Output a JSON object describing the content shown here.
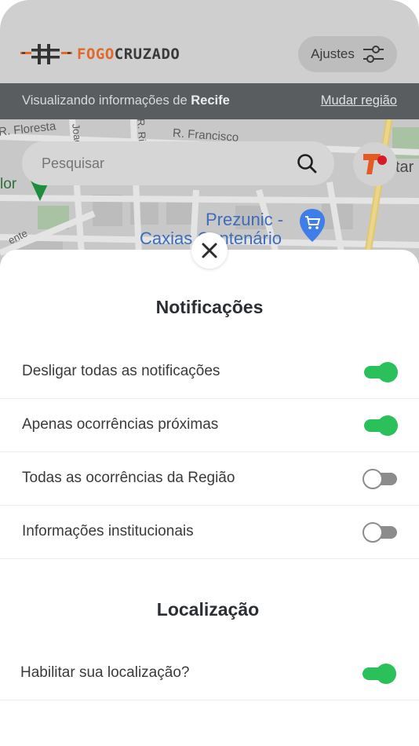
{
  "header": {
    "logo": {
      "text_accent": "FOGO",
      "text_main": "CRUZADO",
      "accent_color": "#e16a2a"
    },
    "settings_label": "Ajustes"
  },
  "region": {
    "prefix": "Visualizando informações de ",
    "city": "Recife",
    "change_label": "Mudar região"
  },
  "map": {
    "streets": [
      "R. Floresta",
      "Joaq",
      "R. Francisco",
      "R. Ri",
      "lor",
      "ente",
      "tar"
    ],
    "poi": {
      "line1": "Prezunic -",
      "line2": "Caxias Centenário"
    }
  },
  "search": {
    "placeholder": "Pesquisar"
  },
  "notifications": {
    "title": "Notificações",
    "items": [
      {
        "label": "Desligar todas as notificações",
        "enabled": true
      },
      {
        "label": "Apenas ocorrências próximas",
        "enabled": true
      },
      {
        "label": "Todas as ocorrências da Região",
        "enabled": false
      },
      {
        "label": "Informações institucionais",
        "enabled": false
      }
    ]
  },
  "location": {
    "title": "Localização",
    "items": [
      {
        "label": "Habilitar sua localização?",
        "enabled": true
      }
    ]
  },
  "colors": {
    "toggle_on": "#2ac05a",
    "toggle_off": "#8c8c8c",
    "region_bar": "#5a5d60",
    "header": "#cfcfcf"
  }
}
